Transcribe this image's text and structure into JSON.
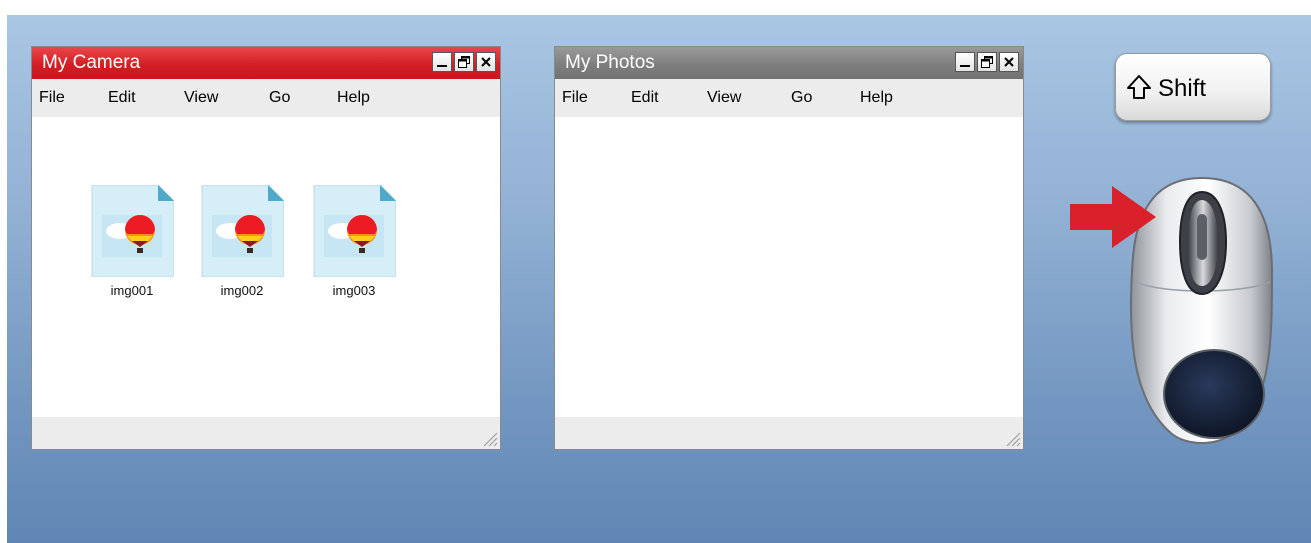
{
  "windows": {
    "camera": {
      "title": "My Camera",
      "menu": [
        "File",
        "Edit",
        "View",
        "Go",
        "Help"
      ],
      "files": [
        "img001",
        "img002",
        "img003"
      ]
    },
    "photos": {
      "title": "My Photos",
      "menu": [
        "File",
        "Edit",
        "View",
        "Go",
        "Help"
      ]
    }
  },
  "window_buttons": {
    "minimize": "_",
    "maximize": "🗗",
    "close": "×"
  },
  "shift_key": {
    "label": "Shift",
    "icon": "shift-arrow-icon"
  },
  "icons": {
    "file": "image-file-balloon-icon",
    "mouse": "computer-mouse-icon",
    "arrow": "red-arrow-icon"
  },
  "colors": {
    "camera_titlebar": "#d41f24",
    "photos_titlebar": "#7f7f7f",
    "desktop_top": "#a9c6e3",
    "desktop_bottom": "#5f86b5",
    "arrow": "#d9202b"
  }
}
